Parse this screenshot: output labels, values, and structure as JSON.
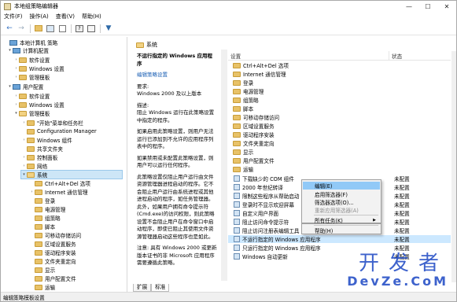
{
  "window": {
    "title": "本地组策略编辑器",
    "controls": [
      "—",
      "☐",
      "✕"
    ]
  },
  "menu": [
    "文件(F)",
    "操作(A)",
    "查看(V)",
    "帮助(H)"
  ],
  "tree": [
    {
      "label": "本地计算机 策略",
      "indent": 0,
      "icon": "pc",
      "arrow": ""
    },
    {
      "label": "计算机配置",
      "indent": 1,
      "icon": "pc",
      "arrow": "▾"
    },
    {
      "label": "软件设置",
      "indent": 2,
      "icon": "folder",
      "arrow": "›"
    },
    {
      "label": "Windows 设置",
      "indent": 2,
      "icon": "folder",
      "arrow": "›"
    },
    {
      "label": "管理模板",
      "indent": 2,
      "icon": "folder",
      "arrow": "›"
    },
    {
      "label": "用户配置",
      "indent": 1,
      "icon": "pc",
      "arrow": "▾"
    },
    {
      "label": "软件设置",
      "indent": 2,
      "icon": "folder",
      "arrow": "›"
    },
    {
      "label": "Windows 设置",
      "indent": 2,
      "icon": "folder",
      "arrow": "›"
    },
    {
      "label": "管理模板",
      "indent": 2,
      "icon": "folder",
      "arrow": "▾"
    },
    {
      "label": "\"开始\"菜单和任务栏",
      "indent": 3,
      "icon": "folder",
      "arrow": "›"
    },
    {
      "label": "Configuration Manager",
      "indent": 3,
      "icon": "folder",
      "arrow": ""
    },
    {
      "label": "Windows 组件",
      "indent": 3,
      "icon": "folder",
      "arrow": "›"
    },
    {
      "label": "共享文件夹",
      "indent": 3,
      "icon": "folder",
      "arrow": ""
    },
    {
      "label": "控制面板",
      "indent": 3,
      "icon": "folder",
      "arrow": "›"
    },
    {
      "label": "网络",
      "indent": 3,
      "icon": "folder",
      "arrow": "›"
    },
    {
      "label": "系统",
      "indent": 3,
      "icon": "folder-open",
      "arrow": "▾",
      "selected": true
    },
    {
      "label": "Ctrl+Alt+Del 选项",
      "indent": 4,
      "icon": "folder",
      "arrow": ""
    },
    {
      "label": "Internet 通信管理",
      "indent": 4,
      "icon": "folder",
      "arrow": "›"
    },
    {
      "label": "登录",
      "indent": 4,
      "icon": "folder",
      "arrow": ""
    },
    {
      "label": "电源管理",
      "indent": 4,
      "icon": "folder",
      "arrow": ""
    },
    {
      "label": "组策略",
      "indent": 4,
      "icon": "folder",
      "arrow": ""
    },
    {
      "label": "脚本",
      "indent": 4,
      "icon": "folder",
      "arrow": ""
    },
    {
      "label": "可移动存储访问",
      "indent": 4,
      "icon": "folder",
      "arrow": ""
    },
    {
      "label": "区域设置服务",
      "indent": 4,
      "icon": "folder",
      "arrow": ""
    },
    {
      "label": "驱动程序安装",
      "indent": 4,
      "icon": "folder",
      "arrow": ""
    },
    {
      "label": "文件夹重定向",
      "indent": 4,
      "icon": "folder",
      "arrow": ""
    },
    {
      "label": "显示",
      "indent": 4,
      "icon": "folder",
      "arrow": ""
    },
    {
      "label": "用户配置文件",
      "indent": 4,
      "icon": "folder",
      "arrow": ""
    },
    {
      "label": "运输",
      "indent": 4,
      "icon": "folder",
      "arrow": ""
    }
  ],
  "path": {
    "label": "系统"
  },
  "description": {
    "title": "不运行指定的 Windows 应用程序",
    "edit_link": "编辑策略设置",
    "requirement_label": "要求:",
    "requirement": "Windows 2000 及以上版本",
    "desc_label": "描述:",
    "desc": "阻止 Windows 运行在此策略设置中指定的程序。",
    "p1": "如果启用此策略设置，则用户无法运行已添加到不允许的应用程序列表中的程序。",
    "p2": "如果禁用或未配置此策略设置，则用户可以运行任何程序。",
    "p3": "此策略设置仅阻止用户运行由文件资源管理器进程启动的程序。它不会阻止用户运行由系统进程或其他进程启动的程序，如任务管理器。此外，如果用户拥有命令提示符(Cmd.exe)的访问权限，则此策略设置不会阻止用户在命令窗口中启动程序，即使已阻止其使用文件资源管理器启动这些程序也是如此。",
    "p4": "注意: 具有 Windows 2000 或更新版本证书的非 Microsoft 应用程序需要遵循此策略。"
  },
  "list": {
    "col_setting": "设置",
    "col_state": "状态",
    "folders": [
      "Ctrl+Alt+Del 选项",
      "Internet 通信管理",
      "登录",
      "电源管理",
      "组策略",
      "脚本",
      "可移动存储访问",
      "区域设置服务",
      "驱动程序安装",
      "文件夹重定向",
      "显示",
      "用户配置文件",
      "运输"
    ],
    "policies": [
      {
        "name": "下载缺少的 COM 组件",
        "state": "未配置"
      },
      {
        "name": "2000 年世纪转译",
        "state": "未配置"
      },
      {
        "name": "限制这些程序从帮助启动",
        "state": "未配置"
      },
      {
        "name": "登录时不显示欢迎屏幕",
        "state": "未配置"
      },
      {
        "name": "自定义用户界面",
        "state": "未配置"
      },
      {
        "name": "阻止访问命令提示符",
        "state": "未配置"
      },
      {
        "name": "阻止访问注册表编辑工具",
        "state": "未配置"
      },
      {
        "name": "不运行指定的 Windows 应用程序",
        "state": "未配置",
        "highlight": true
      },
      {
        "name": "只运行指定的 Windows 应用程序",
        "state": "未配置"
      },
      {
        "name": "Windows 自动更新",
        "state": "未配置"
      }
    ]
  },
  "context_menu": {
    "edit": "编辑(E)",
    "filter_on": "启用筛选器(F)",
    "filter_options": "筛选器选项(O)...",
    "filter_reapply": "重新应用筛选器(A)",
    "all_tasks": "所有任务(K)",
    "help": "帮助(H)"
  },
  "tabs": [
    "扩展",
    "标准"
  ],
  "status": "编辑策略模板设置",
  "watermark": {
    "top": "开发者",
    "bottom": "DevZe.CoM"
  }
}
